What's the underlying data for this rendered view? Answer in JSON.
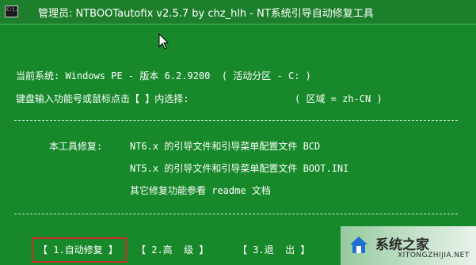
{
  "window": {
    "title": "管理员: NTBOOTautofix v2.5.7 by chz_hlh - NT系统引导自动修复工具",
    "icon": "console-icon",
    "icon_text": "C:\\."
  },
  "console": {
    "current_system": "当前系统: Windows PE - 版本 6.2.9200  ( 活动分区 - C: )",
    "prompt": "键盘输入功能号或鼠标点击【 】内选择:",
    "region": "( 区域 = zh-CN )",
    "separator": "- - - - - - - - - - - - - - - - - - - - - - - - - - - - - - - - - - - - - - - - - - - - - -",
    "info_label": "本工具修复:",
    "info_line1": "NT6.x 的引导文件和引导菜单配置文件 BCD",
    "info_line2": "NT5.x 的引导文件和引导菜单配置文件 BOOT.INI",
    "info_line3": "其它修复功能参看 readme 文档"
  },
  "menu": {
    "auto_repair": "【 1.自动修复 】",
    "advanced": "【 2.高  级 】",
    "exit": "【 3.退  出 】"
  },
  "watermark": {
    "text": "系统之家",
    "url": "XITONGZHIJIA.NET"
  },
  "colors": {
    "background": "#17892a",
    "text": "#ffffff",
    "highlight_border": "#c9302c"
  }
}
